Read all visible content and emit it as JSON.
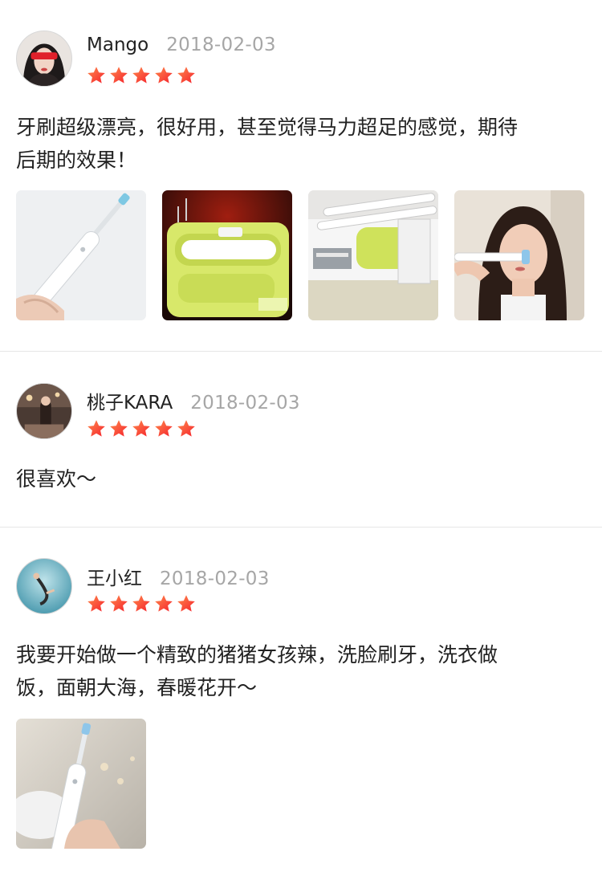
{
  "reviews": [
    {
      "username": "Mango",
      "date": "2018-02-03",
      "rating": 5,
      "text_lines": [
        "牙刷超级漂亮，很好用，甚至觉得马力超足的感觉，期待",
        "后期的效果！"
      ],
      "photo_count": 4
    },
    {
      "username": "桃子KARA",
      "date": "2018-02-03",
      "rating": 5,
      "text_lines": [
        "很喜欢～"
      ],
      "photo_count": 0
    },
    {
      "username": "王小红",
      "date": "2018-02-03",
      "rating": 5,
      "text_lines": [
        "我要开始做一个精致的猪猪女孩辣，洗脸刷牙，洗衣做",
        "饭，面朝大海，春暖花开～"
      ],
      "photo_count": 1
    }
  ],
  "colors": {
    "star_start": "#ff7a45",
    "star_end": "#f5222d",
    "date_gray": "#a6a6a6",
    "divider": "#e6e6e6"
  }
}
